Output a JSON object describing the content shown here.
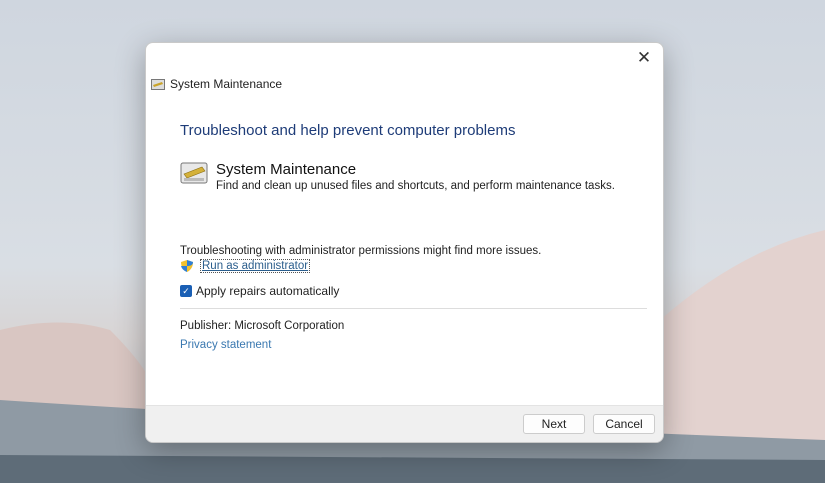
{
  "window": {
    "title": "System Maintenance",
    "close_icon": "close-icon"
  },
  "heading": "Troubleshoot and help prevent computer problems",
  "troubleshooter": {
    "name": "System Maintenance",
    "description": "Find and clean up unused files and shortcuts, and perform maintenance tasks."
  },
  "admin": {
    "note": "Troubleshooting with administrator permissions might find more issues.",
    "link": "Run as administrator"
  },
  "apply_repairs": {
    "label": "Apply repairs automatically",
    "checked": true
  },
  "publisher": "Publisher:  Microsoft Corporation",
  "privacy": "Privacy statement",
  "buttons": {
    "next": "Next",
    "cancel": "Cancel"
  }
}
